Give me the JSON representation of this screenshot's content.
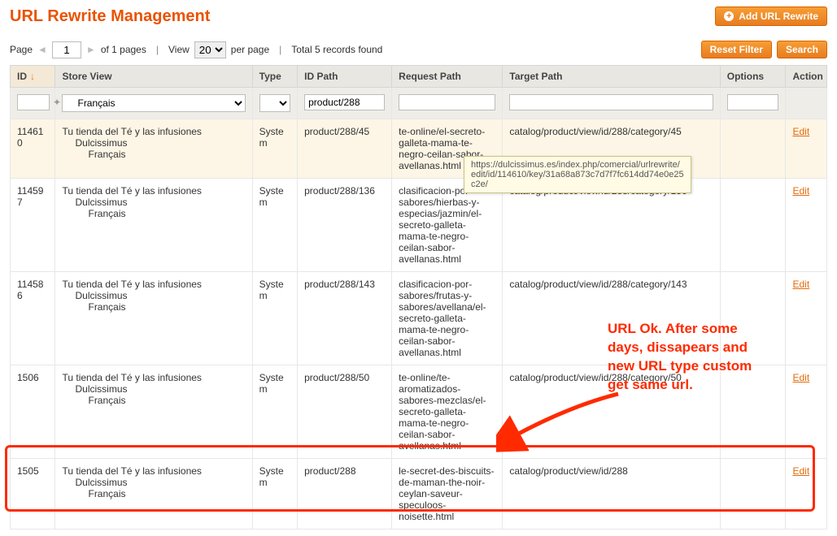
{
  "header": {
    "title": "URL Rewrite Management",
    "add_button": "Add URL Rewrite"
  },
  "toolbar": {
    "page_label": "Page",
    "page_value": "1",
    "pages_text": "of 1 pages",
    "view_label": "View",
    "per_page_value": "20",
    "per_page_label": "per page",
    "total_label": "Total 5 records found",
    "reset_filter": "Reset Filter",
    "search": "Search"
  },
  "columns": {
    "id": "ID",
    "store_view": "Store View",
    "type": "Type",
    "id_path": "ID Path",
    "request_path": "Request Path",
    "target_path": "Target Path",
    "options": "Options",
    "action": "Action"
  },
  "filters": {
    "store_view_selected": "Français",
    "id_path_value": "product/288"
  },
  "store_tree": {
    "lvl1": "Tu tienda del Té y las infusiones",
    "lvl2": "Dulcissimus",
    "lvl3": "Français"
  },
  "rows": [
    {
      "id": "114610",
      "type": "System",
      "id_path": "product/288/45",
      "request_path": "te-online/el-secreto-galleta-mama-te-negro-ceilan-sabor-avellanas.html",
      "target_path": "catalog/product/view/id/288/category/45",
      "options": "",
      "action": "Edit",
      "highlight": true
    },
    {
      "id": "114597",
      "type": "System",
      "id_path": "product/288/136",
      "request_path": "clasificacion-por-sabores/hierbas-y-especias/jazmin/el-secreto-galleta-mama-te-negro-ceilan-sabor-avellanas.html",
      "target_path": "catalog/product/view/id/288/category/136",
      "options": "",
      "action": "Edit",
      "highlight": false
    },
    {
      "id": "114586",
      "type": "System",
      "id_path": "product/288/143",
      "request_path": "clasificacion-por-sabores/frutas-y-sabores/avellana/el-secreto-galleta-mama-te-negro-ceilan-sabor-avellanas.html",
      "target_path": "catalog/product/view/id/288/category/143",
      "options": "",
      "action": "Edit",
      "highlight": false
    },
    {
      "id": "1506",
      "type": "System",
      "id_path": "product/288/50",
      "request_path": "te-online/te-aromatizados-sabores-mezclas/el-secreto-galleta-mama-te-negro-ceilan-sabor-avellanas.html",
      "target_path": "catalog/product/view/id/288/category/50",
      "options": "",
      "action": "Edit",
      "highlight": false
    },
    {
      "id": "1505",
      "type": "System",
      "id_path": "product/288",
      "request_path": "le-secret-des-biscuits-de-maman-the-noir-ceylan-saveur-speculoos-noisette.html",
      "target_path": "catalog/product/view/id/288",
      "options": "",
      "action": "Edit",
      "highlight": false
    }
  ],
  "tooltip": "https://dulcissimus.es/index.php/comercial/urlrewrite/edit/id/114610/key/31a68a873c7d7f7fc614dd74e0e25c2e/",
  "annotation_lines": {
    "l1": "URL Ok. After some",
    "l2": "days, dissapears and",
    "l3": "new URL type custom",
    "l4": "get same url."
  }
}
